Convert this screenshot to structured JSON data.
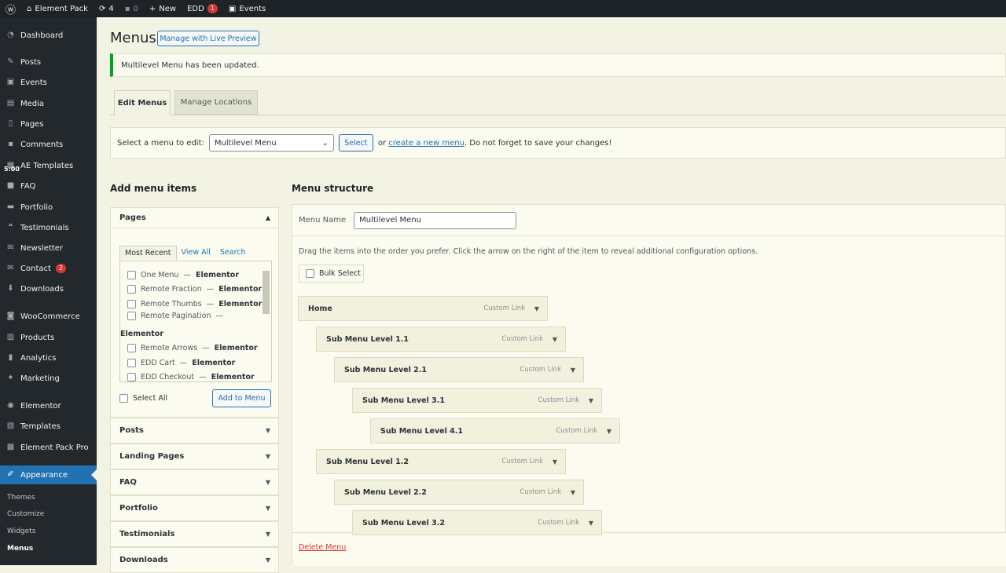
{
  "adminbar": {
    "site": "Element Pack",
    "updates": "4",
    "comments": "0",
    "new": "New",
    "edd": "EDD",
    "edd_badge": "1",
    "events": "Events"
  },
  "sidebar": {
    "items": [
      {
        "label": "Dashboard",
        "icon": "dashboard-icon"
      },
      {
        "label": "Posts",
        "icon": "pin-icon"
      },
      {
        "label": "Events",
        "icon": "calendar-icon"
      },
      {
        "label": "Media",
        "icon": "media-icon"
      },
      {
        "label": "Pages",
        "icon": "page-icon"
      },
      {
        "label": "Comments",
        "icon": "comment-icon"
      },
      {
        "label": "AE Templates",
        "icon": "template-icon"
      },
      {
        "label": "FAQ",
        "icon": "faq-icon"
      },
      {
        "label": "Portfolio",
        "icon": "portfolio-icon"
      },
      {
        "label": "Testimonials",
        "icon": "testimonial-icon"
      },
      {
        "label": "Newsletter",
        "icon": "newsletter-icon"
      },
      {
        "label": "Contact",
        "icon": "mail-icon",
        "badge": "2"
      },
      {
        "label": "Downloads",
        "icon": "download-icon"
      },
      {
        "label": "WooCommerce",
        "icon": "woocommerce-icon"
      },
      {
        "label": "Products",
        "icon": "products-icon"
      },
      {
        "label": "Analytics",
        "icon": "analytics-icon"
      },
      {
        "label": "Marketing",
        "icon": "marketing-icon"
      },
      {
        "label": "Elementor",
        "icon": "elementor-icon"
      },
      {
        "label": "Templates",
        "icon": "templates-icon"
      },
      {
        "label": "Element Pack Pro",
        "icon": "element-pack-icon"
      },
      {
        "label": "Appearance",
        "icon": "brush-icon"
      }
    ],
    "overlay_time": "5:00",
    "submenu": [
      "Themes",
      "Customize",
      "Widgets",
      "Menus"
    ]
  },
  "page": {
    "title": "Menus",
    "live_preview": "Manage with Live Preview",
    "notice": "Multilevel Menu has been updated.",
    "tabs": [
      "Edit Menus",
      "Manage Locations"
    ],
    "select_label": "Select a menu to edit:",
    "selected_menu": "Multilevel Menu",
    "select_btn": "Select",
    "or": "or",
    "create_link": "create a new menu",
    "save_hint": ". Do not forget to save your changes!"
  },
  "add_items": {
    "heading": "Add menu items",
    "pages_title": "Pages",
    "subtabs": [
      "Most Recent",
      "View All",
      "Search"
    ],
    "pages": [
      {
        "name": "One Menu",
        "suffix": "Elementor"
      },
      {
        "name": "Remote Fraction",
        "suffix": "Elementor"
      },
      {
        "name": "Remote Thumbs",
        "suffix": "Elementor"
      },
      {
        "name": "Remote Pagination",
        "suffix": "Elementor"
      },
      {
        "name": "Remote Arrows",
        "suffix": "Elementor"
      },
      {
        "name": "EDD Cart",
        "suffix": "Elementor"
      },
      {
        "name": "EDD Checkout",
        "suffix": "Elementor"
      }
    ],
    "dash": " — ",
    "select_all": "Select All",
    "add_btn": "Add to Menu",
    "sections": [
      "Posts",
      "Landing Pages",
      "FAQ",
      "Portfolio",
      "Testimonials",
      "Downloads"
    ]
  },
  "structure": {
    "heading": "Menu structure",
    "name_label": "Menu Name",
    "name_value": "Multilevel Menu",
    "instructions": "Drag the items into the order you prefer. Click the arrow on the right of the item to reveal additional configuration options.",
    "bulk_select": "Bulk Select",
    "items": [
      {
        "title": "Home",
        "type": "Custom Link",
        "depth": 0
      },
      {
        "title": "Sub Menu Level 1.1",
        "type": "Custom Link",
        "depth": 1
      },
      {
        "title": "Sub Menu Level 2.1",
        "type": "Custom Link",
        "depth": 2
      },
      {
        "title": "Sub Menu Level 3.1",
        "type": "Custom Link",
        "depth": 3
      },
      {
        "title": "Sub Menu Level 4.1",
        "type": "Custom Link",
        "depth": 4
      },
      {
        "title": "Sub Menu Level 1.2",
        "type": "Custom Link",
        "depth": 1
      },
      {
        "title": "Sub Menu Level 2.2",
        "type": "Custom Link",
        "depth": 2
      },
      {
        "title": "Sub Menu Level 3.2",
        "type": "Custom Link",
        "depth": 3
      }
    ],
    "delete": "Delete Menu"
  }
}
